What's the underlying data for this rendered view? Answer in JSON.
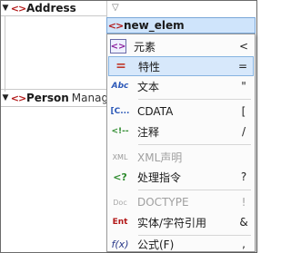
{
  "tree": {
    "address": {
      "label": "Address"
    },
    "person": {
      "label": "Person",
      "suffix": "Manage"
    }
  },
  "new_element": {
    "label": "new_elem"
  },
  "menu": {
    "items": [
      {
        "icon": "element-icon",
        "glyph": "<>",
        "label": "元素",
        "shortcut": "<",
        "selected": false,
        "disabled": false
      },
      {
        "icon": "attribute-icon",
        "glyph": "=",
        "label": "特性",
        "shortcut": "=",
        "selected": true,
        "disabled": false
      },
      {
        "icon": "text-icon",
        "glyph": "Abc",
        "label": "文本",
        "shortcut": "\"",
        "selected": false,
        "disabled": false
      },
      {
        "icon": "cdata-icon",
        "glyph": "[C...",
        "label": "CDATA",
        "shortcut": "[",
        "selected": false,
        "disabled": false
      },
      {
        "icon": "comment-icon",
        "glyph": "<!--",
        "label": "注释",
        "shortcut": "/",
        "selected": false,
        "disabled": false
      },
      {
        "icon": "xml-declaration-icon",
        "glyph": "XML",
        "label": "XML声明",
        "shortcut": "",
        "selected": false,
        "disabled": true
      },
      {
        "icon": "processing-instruction-icon",
        "glyph": "<?",
        "label": "处理指令",
        "shortcut": "?",
        "selected": false,
        "disabled": false
      },
      {
        "icon": "doctype-icon",
        "glyph": "Doc",
        "label": "DOCTYPE",
        "shortcut": "!",
        "selected": false,
        "disabled": true
      },
      {
        "icon": "entity-reference-icon",
        "glyph": "Ent",
        "label": "实体/字符引用",
        "shortcut": "&",
        "selected": false,
        "disabled": false
      },
      {
        "icon": "formula-icon",
        "glyph": "f(x)",
        "label": "公式(F)",
        "shortcut": ",",
        "selected": false,
        "disabled": false
      }
    ]
  }
}
